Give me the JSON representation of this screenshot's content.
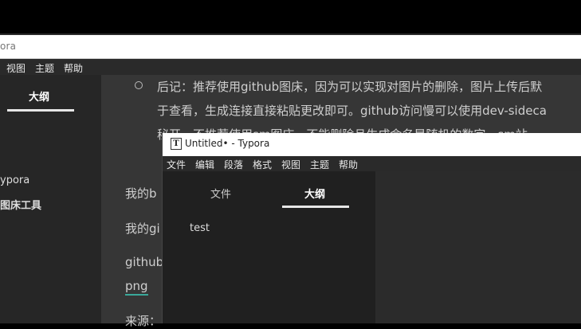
{
  "background_window": {
    "title_partial": "ora",
    "menu": [
      "视图",
      "主题",
      "帮助"
    ],
    "sidebar": {
      "active_tab": "大纲",
      "items": [
        "ypora",
        "图床工具"
      ]
    },
    "editor": {
      "bullet_line1": "后记：推荐使用github图床，因为可以实现对图片的删除，图片上传后默",
      "bullet_line2": "于查看，生成连接直接粘贴更改即可。github访问慢可以使用dev-sideca",
      "bullet_line3": "秘开，不推荐使用sm图床，不能删除且生成命名是随机的数字，sm站",
      "para1": "我的b",
      "para2": "我的gi",
      "para3": "github",
      "link": "png",
      "para4": "来源："
    }
  },
  "foreground_window": {
    "title": "Untitled• - Typora",
    "app_icon_letter": "T",
    "menu": [
      "文件",
      "编辑",
      "段落",
      "格式",
      "视图",
      "主题",
      "帮助"
    ],
    "sidebar": {
      "tabs": [
        "文件",
        "大纲"
      ],
      "active_tab": "大纲",
      "outline_items": [
        "test"
      ]
    }
  }
}
